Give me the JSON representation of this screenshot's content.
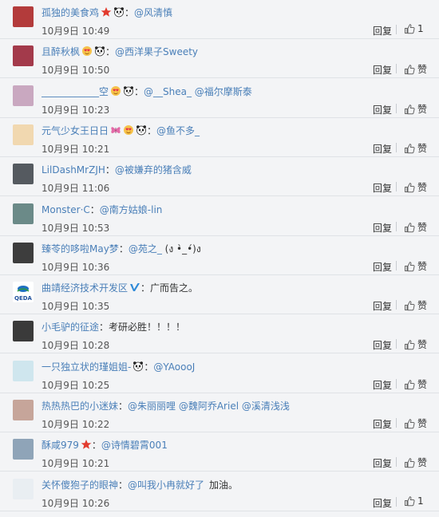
{
  "comments": [
    {
      "user": "孤独的美食鸡",
      "badges": [
        "star-badge",
        "panda-badge"
      ],
      "sep": "：",
      "text": "",
      "mention": "@风清慎",
      "time": "10月9日 10:49",
      "reply": "回复",
      "like": "1",
      "avatar_color": "#b33b3b"
    },
    {
      "user": "且醉秋枫",
      "badges": [
        "heart-eyes-badge",
        "panda-badge"
      ],
      "sep": "：",
      "text": "",
      "mention": "@西洋果子Sweety",
      "time": "10月9日 10:50",
      "reply": "回复",
      "like": "赞",
      "avatar_color": "#a33a4b"
    },
    {
      "user": "____________空",
      "badges": [
        "heart-eyes-badge",
        "panda-badge"
      ],
      "sep": "：",
      "text": "",
      "mention": "@__Shea_ @福尔摩斯泰",
      "time": "10月9日 10:23",
      "reply": "回复",
      "like": "赞",
      "avatar_color": "#c9a8c0"
    },
    {
      "user": "元气少女王日日",
      "badges": [
        "butterfly-badge",
        "heart-eyes-badge",
        "panda-badge"
      ],
      "sep": "：",
      "text": "",
      "mention": "@鱼不多_",
      "time": "10月9日 10:21",
      "reply": "回复",
      "like": "赞",
      "avatar_color": "#f1d8b0"
    },
    {
      "user": "LilDashMrZJH",
      "badges": [],
      "sep": "：",
      "text": "",
      "mention": "@被嫌弃的猪含威",
      "time": "10月9日 11:06",
      "reply": "回复",
      "like": "赞",
      "avatar_color": "#555a60"
    },
    {
      "user": "Monster·C",
      "badges": [],
      "sep": "：",
      "text": "",
      "mention": "@南方姑娘-lin",
      "time": "10月9日 10:53",
      "reply": "回复",
      "like": "赞",
      "avatar_color": "#6b8a88"
    },
    {
      "user": "臻苓的哆啦May梦",
      "badges": [],
      "sep": "：",
      "text": "",
      "mention": "@苑之_",
      "extra": " (ง •̀_•́)ง",
      "time": "10月9日 10:36",
      "reply": "回复",
      "like": "赞",
      "avatar_color": "#3d3d3d"
    },
    {
      "user": "曲靖经济技术开发区",
      "badges": [
        "verified-badge"
      ],
      "sep": "：",
      "text": "广而告之。",
      "mention": "",
      "time": "10月9日 10:35",
      "reply": "回复",
      "like": "赞",
      "avatar_color": "#ffffff",
      "avatar_label": "QEDA"
    },
    {
      "user": "小毛驴的征途",
      "badges": [],
      "sep": "：",
      "text": "考研必胜！！！！",
      "mention": "",
      "time": "10月9日 10:28",
      "reply": "回复",
      "like": "赞",
      "avatar_color": "#3a3a3a"
    },
    {
      "user": "一只独立状的瑾姐姐-",
      "badges": [
        "panda-badge"
      ],
      "sep": "：",
      "text": "",
      "mention": "@YAoooJ",
      "time": "10月9日 10:25",
      "reply": "回复",
      "like": "赞",
      "avatar_color": "#cfe6ee"
    },
    {
      "user": "热热热巴的小迷妹",
      "badges": [],
      "sep": "：",
      "text": "",
      "mention": "@朱丽丽哩 @魏阿乔Ariel @溪清浅浅",
      "time": "10月9日 10:22",
      "reply": "回复",
      "like": "赞",
      "avatar_color": "#c6a59a"
    },
    {
      "user": "酥咸979",
      "badges": [
        "star-badge"
      ],
      "sep": "：",
      "text": "",
      "mention": "@诗情碧霄001",
      "time": "10月9日 10:21",
      "reply": "回复",
      "like": "赞",
      "avatar_color": "#8fa4b8"
    },
    {
      "user": "关怀傻狍子的眼神",
      "badges": [],
      "sep": "：",
      "text": "加油。",
      "mention": "@叫我小冉就好了",
      "time": "10月9日 10:26",
      "reply": "回复",
      "like": "1",
      "avatar_color": "#e9eef2"
    }
  ]
}
